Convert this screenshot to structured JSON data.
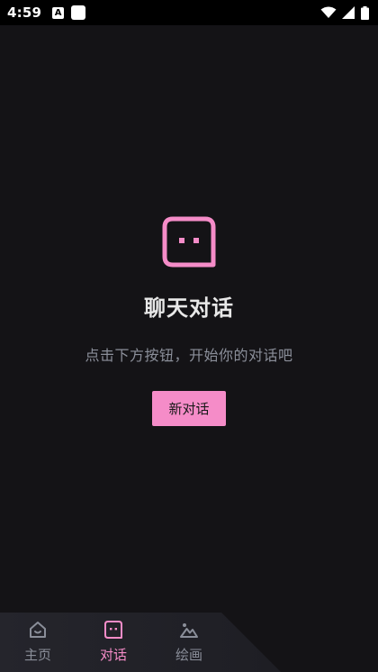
{
  "status_bar": {
    "time": "4:59",
    "notification_letter": "A",
    "icons": [
      "wifi-icon",
      "cell-signal-icon",
      "battery-icon"
    ]
  },
  "empty_state": {
    "icon": "chat-bubble-icon",
    "title": "聊天对话",
    "subtitle": "点击下方按钮，开始你的对话吧",
    "button_label": "新对话"
  },
  "bottom_nav": {
    "active": "对话",
    "items": [
      {
        "label": "主页",
        "icon": "home-icon"
      },
      {
        "label": "对话",
        "icon": "chat-icon"
      },
      {
        "label": "绘画",
        "icon": "mountain-image-icon"
      }
    ]
  },
  "colors": {
    "accent": "#f58cc8",
    "background": "#141316",
    "nav_panel": "#23232a",
    "muted_text": "#8b8f9a"
  }
}
